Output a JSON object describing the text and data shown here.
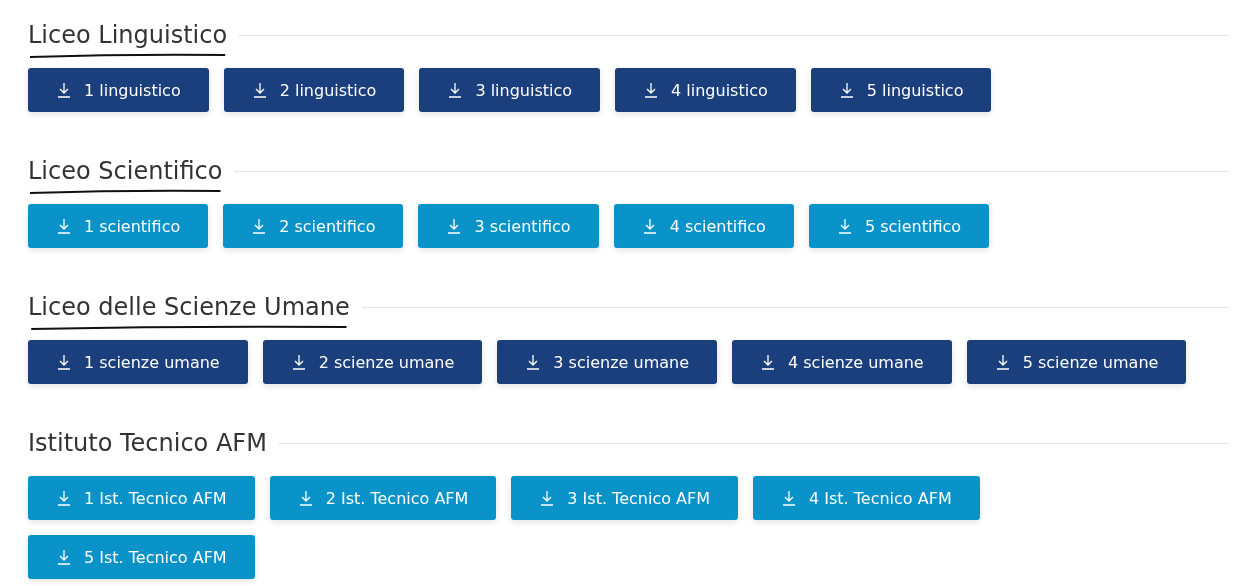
{
  "sections": [
    {
      "title": "Liceo Linguistico",
      "underlined": true,
      "color": "#1b3f7c",
      "buttons": [
        "1 linguistico",
        "2 linguistico",
        "3 linguistico",
        "4 linguistico",
        "5 linguistico"
      ]
    },
    {
      "title": "Liceo Scientifico",
      "underlined": true,
      "color": "#0993c9",
      "buttons": [
        "1 scientifico",
        "2 scientifico",
        "3 scientifico",
        "4 scientifico",
        "5 scientifico"
      ]
    },
    {
      "title": "Liceo delle Scienze Umane",
      "underlined": true,
      "color": "#1b3f7c",
      "buttons": [
        "1 scienze umane",
        "2 scienze umane",
        "3 scienze umane",
        "4 scienze umane",
        "5 scienze umane"
      ]
    },
    {
      "title": "Istituto Tecnico AFM",
      "underlined": false,
      "color": "#0993c9",
      "buttons": [
        "1 Ist. Tecnico AFM",
        "2 Ist. Tecnico AFM",
        "3 Ist. Tecnico AFM",
        "4 Ist. Tecnico AFM",
        "5 Ist. Tecnico AFM"
      ]
    }
  ]
}
